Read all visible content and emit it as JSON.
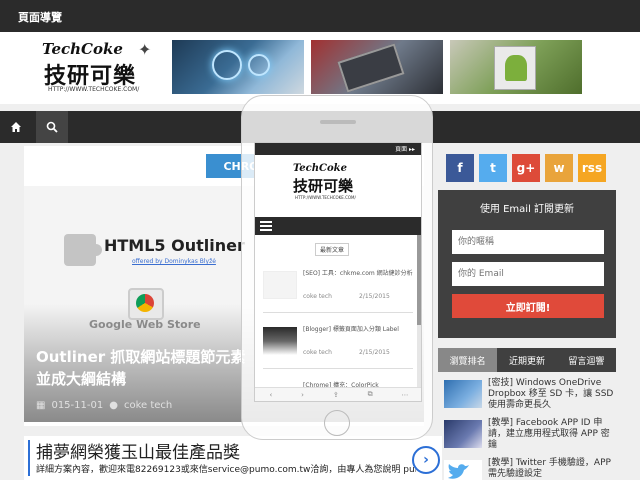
{
  "topbar": {
    "nav_label": "頁面導覽"
  },
  "header": {
    "logo_line1": "TechCoke",
    "logo_line2": "技研可樂",
    "logo_url": "HTTP://WWW.TECHCOKE.COM/"
  },
  "navbar": {
    "home_icon": "home-icon",
    "search_icon": "search-icon"
  },
  "main": {
    "category_tag": "CHRO",
    "feature": {
      "title": "HTML5 Outliner",
      "subtitle": "offered by Dominykas Blyžė",
      "store_label": "Google Web Store",
      "headline": "Outliner 抓取網站標題節元素並成大綱結構",
      "date": "015-11-01",
      "author": "coke tech"
    }
  },
  "ad": {
    "title": "捕夢網榮獲玉山最佳產品獎",
    "description": "詳細方案內容，歡迎來電82269123或來信service@pumo.com.tw洽詢，由專人為您說明 pumo.com.tw"
  },
  "sidebar": {
    "social": [
      "f",
      "t",
      "g+",
      "w",
      "rss"
    ],
    "subscribe": {
      "title": "使用 Email 訂閱更新",
      "name_placeholder": "你的暱稱",
      "email_placeholder": "你的 Email",
      "button": "立即訂閱!"
    },
    "tabs": [
      "瀏覽排名",
      "近期更新",
      "留言迴響"
    ],
    "posts": [
      {
        "title": "[密技] Windows OneDrive Dropbox 移至 SD 卡，讓 SSD 使用壽命更長久"
      },
      {
        "title": "[教學] Facebook APP ID 申請，建立應用程式取得 APP 密鑰"
      },
      {
        "title": "[教學] Twitter 手機驗證，APP 需先驗證設定"
      }
    ]
  },
  "phone": {
    "status": "頁面 ▸▸",
    "logo_line1": "TechCoke",
    "logo_line2": "技研可樂",
    "logo_url": "HTTP://WWW.TECHCOKE.COM/",
    "section": "最新文章",
    "posts": [
      {
        "title": "[SEO] 工具：chkme.com 網站健診分析",
        "author": "coke tech",
        "date": "2/15/2015"
      },
      {
        "title": "[Blogger] 標籤頁面加入分類 Label",
        "author": "coke tech",
        "date": "2/15/2015"
      },
      {
        "title": "[Chrome] 擴充：ColorPick",
        "author": "",
        "date": ""
      }
    ],
    "nav": [
      "‹",
      "›",
      "⇪",
      "⧉",
      "⋯"
    ]
  }
}
